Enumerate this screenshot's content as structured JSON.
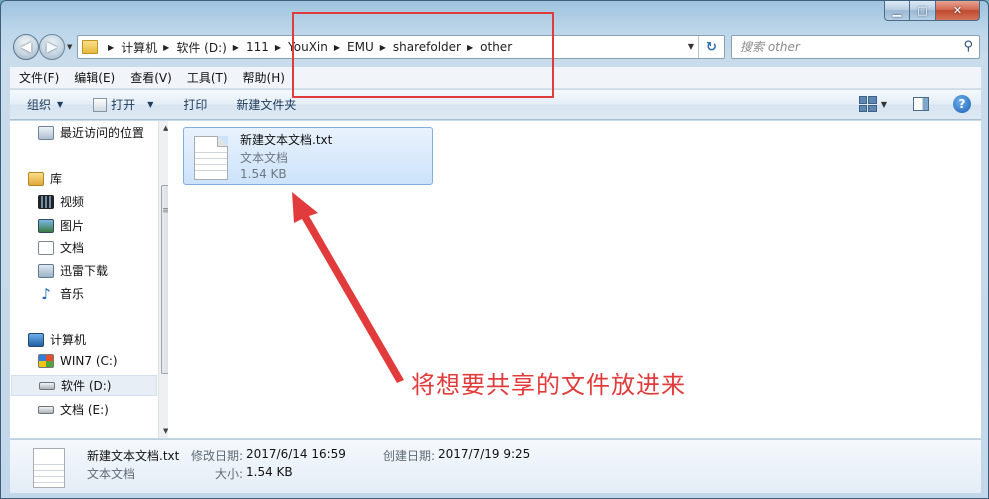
{
  "window": {
    "minimize_glyph": "▁",
    "maximize_glyph": "□",
    "close_glyph": "✕"
  },
  "address_bar": {
    "breadcrumbs": [
      "计算机",
      "软件 (D:)",
      "111",
      "YouXin",
      "EMU",
      "sharefolder",
      "other"
    ]
  },
  "search": {
    "placeholder": "搜索 other"
  },
  "menu": {
    "items": [
      "文件(F)",
      "编辑(E)",
      "查看(V)",
      "工具(T)",
      "帮助(H)"
    ]
  },
  "toolbar": {
    "organize_label": "组织",
    "open_label": "打开",
    "print_label": "打印",
    "new_folder_label": "新建文件夹",
    "help_glyph": "?"
  },
  "nav_pane": {
    "recent": "最近访问的位置",
    "libraries": "库",
    "videos": "视频",
    "pictures": "图片",
    "documents": "文档",
    "downloads": "迅雷下载",
    "music": "音乐",
    "computer": "计算机",
    "drive_c": "WIN7 (C:)",
    "drive_d": "软件 (D:)",
    "drive_e": "文档 (E:)"
  },
  "file": {
    "name": "新建文本文档.txt",
    "type": "文本文档",
    "size": "1.54 KB"
  },
  "details": {
    "name": "新建文本文档.txt",
    "type": "文本文档",
    "modified_label": "修改日期:",
    "modified_value": "2017/6/14 16:59",
    "created_label": "创建日期:",
    "created_value": "2017/7/19 9:25",
    "size_label": "大小:",
    "size_value": "1.54 KB"
  },
  "annotation": {
    "text": "将想要共享的文件放进来",
    "color": "#e23b3b"
  }
}
